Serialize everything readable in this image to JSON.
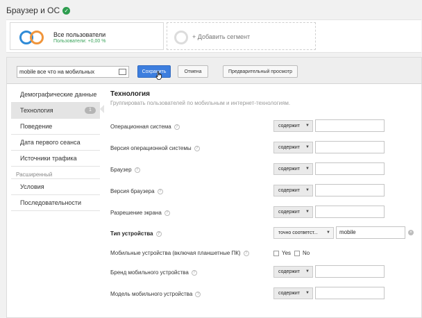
{
  "header": {
    "title": "Браузер и ОС"
  },
  "segments": {
    "current": {
      "name": "Все пользователи",
      "subtitle": "Пользователи: +0,00 %"
    },
    "add_label": "+ Добавить сегмент"
  },
  "editor": {
    "name_value": "mobile все что на мобильных",
    "save_label": "Сохранить",
    "cancel_label": "Отмена",
    "preview_label": "Предварительный просмотр"
  },
  "sidebar": {
    "items": [
      {
        "label": "Демографические данные"
      },
      {
        "label": "Технология",
        "count": "1"
      },
      {
        "label": "Поведение"
      },
      {
        "label": "Дата первого сеанса"
      },
      {
        "label": "Источники трафика"
      }
    ],
    "group_label": "Расширенный",
    "advanced": [
      {
        "label": "Условия"
      },
      {
        "label": "Последовательности"
      }
    ]
  },
  "content": {
    "title": "Технология",
    "description": "Группировать пользователей по мобильным и интернет-технологиям.",
    "rows": [
      {
        "label": "Операционная система",
        "op": "содержит"
      },
      {
        "label": "Версия операционной системы",
        "op": "содержит"
      },
      {
        "label": "Браузер",
        "op": "содержит"
      },
      {
        "label": "Версия браузера",
        "op": "содержит"
      },
      {
        "label": "Разрешение экрана",
        "op": "содержит"
      }
    ],
    "device": {
      "label": "Тип устройства",
      "op": "точно соответст...",
      "value": "mobile"
    },
    "mobile": {
      "label": "Мобильные устройства (включая планшетные ПК)",
      "yes": "Yes",
      "no": "No"
    },
    "rows2": [
      {
        "label": "Бренд мобильного устройства",
        "op": "содержит"
      },
      {
        "label": "Модель мобильного устройства",
        "op": "содержит"
      }
    ]
  }
}
